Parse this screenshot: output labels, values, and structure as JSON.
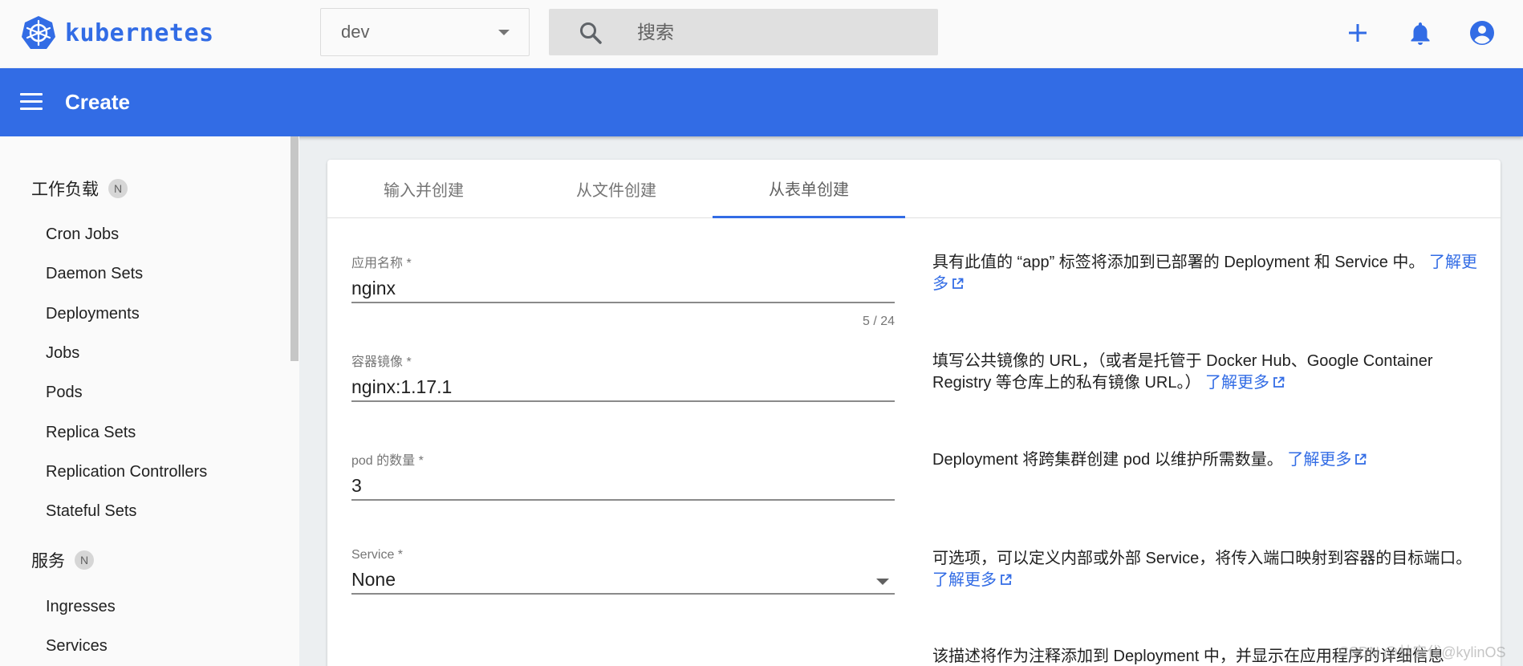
{
  "topbar": {
    "logo_text": "kubernetes",
    "namespace": "dev",
    "search_placeholder": "搜索"
  },
  "appbar": {
    "title": "Create"
  },
  "sidebar": {
    "sections": [
      {
        "label": "工作负载",
        "badge": "N"
      },
      {
        "label": "服务",
        "badge": "N"
      }
    ],
    "workloads": [
      "Cron Jobs",
      "Daemon Sets",
      "Deployments",
      "Jobs",
      "Pods",
      "Replica Sets",
      "Replication Controllers",
      "Stateful Sets"
    ],
    "services": [
      "Ingresses",
      "Services"
    ]
  },
  "tabs": [
    "输入并创建",
    "从文件创建",
    "从表单创建"
  ],
  "active_tab": "从表单创建",
  "form": {
    "app_name": {
      "label": "应用名称 *",
      "value": "nginx",
      "counter": "5 / 24"
    },
    "image": {
      "label": "容器镜像 *",
      "value": "nginx:1.17.1"
    },
    "pods": {
      "label": "pod 的数量 *",
      "value": "3"
    },
    "service": {
      "label": "Service *",
      "value": "None"
    }
  },
  "help": {
    "app_name": "具有此值的 “app” 标签将添加到已部署的 Deployment 和 Service 中。",
    "image": "填写公共镜像的 URL，（或者是托管于 Docker Hub、Google Container Registry 等仓库上的私有镜像 URL。）",
    "pods": "Deployment 将跨集群创建 pod 以维护所需数量。",
    "service": "可选项，可以定义内部或外部 Service，将传入端口映射到容器的目标端口。",
    "description": "该描述将作为注释添加到 Deployment 中，并显示在应用程序的详细信息",
    "learn_more": "了解更多"
  },
  "watermark": "CSDN @林安代@kylinOS",
  "colors": {
    "primary": "#326ce5",
    "sidebar_bg": "#fafafa",
    "page_bg": "#eceff1"
  }
}
